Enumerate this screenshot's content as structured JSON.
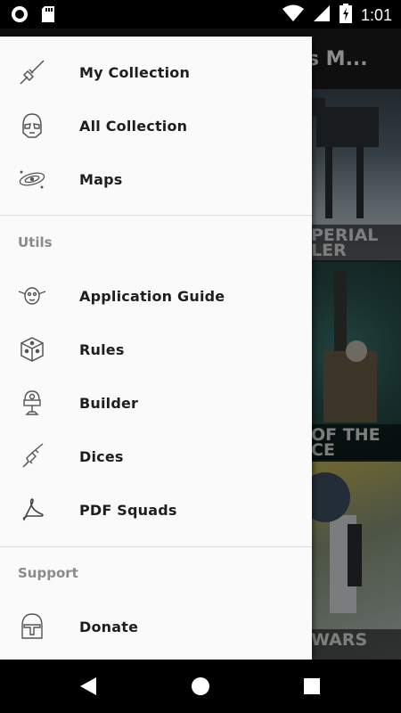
{
  "status_bar": {
    "time": "1:01",
    "battery_level": 0.85
  },
  "background": {
    "title": "es M...",
    "cards": [
      {
        "caption_lines": [
          "PERIAL",
          "LER"
        ]
      },
      {
        "caption_lines": [
          "OF THE",
          "CE"
        ]
      },
      {
        "caption_lines": [
          "WARS"
        ]
      }
    ]
  },
  "drawer": {
    "items": [
      {
        "label": "My Collection",
        "icon": "lightsaber-icon"
      },
      {
        "label": "All Collection",
        "icon": "stormtrooper-helmet-icon"
      },
      {
        "label": "Maps",
        "icon": "galaxy-icon"
      }
    ],
    "sections": [
      {
        "title": "Utils",
        "items": [
          {
            "label": "Application Guide",
            "icon": "yoda-icon"
          },
          {
            "label": "Rules",
            "icon": "cube-icon"
          },
          {
            "label": "Builder",
            "icon": "droid-icon"
          },
          {
            "label": "Dices",
            "icon": "blaster-icon"
          },
          {
            "label": "PDF Squads",
            "icon": "pdf-icon"
          }
        ]
      },
      {
        "title": "Support",
        "items": [
          {
            "label": "Donate",
            "icon": "mandalorian-helmet-icon"
          }
        ]
      }
    ]
  },
  "nav_bar": {
    "buttons": [
      "back-button",
      "home-button",
      "recents-button"
    ]
  }
}
